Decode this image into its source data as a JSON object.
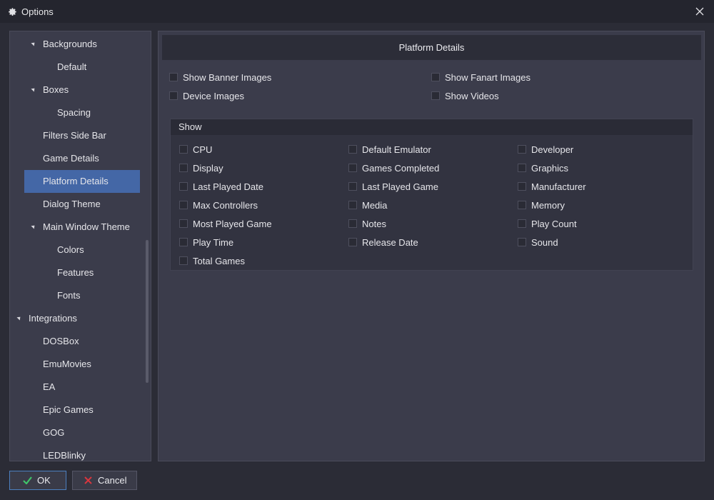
{
  "window": {
    "title": "Options"
  },
  "sidebar": {
    "items": [
      {
        "label": "Backgrounds",
        "level": 1,
        "expanded": true
      },
      {
        "label": "Default",
        "level": 2
      },
      {
        "label": "Boxes",
        "level": 1,
        "expanded": true
      },
      {
        "label": "Spacing",
        "level": 2
      },
      {
        "label": "Filters Side Bar",
        "level": 1
      },
      {
        "label": "Game Details",
        "level": 1
      },
      {
        "label": "Platform Details",
        "level": 1,
        "selected": true
      },
      {
        "label": "Dialog Theme",
        "level": 1
      },
      {
        "label": "Main Window Theme",
        "level": 1,
        "expanded": true
      },
      {
        "label": "Colors",
        "level": 2
      },
      {
        "label": "Features",
        "level": 2
      },
      {
        "label": "Fonts",
        "level": 2
      },
      {
        "label": "Integrations",
        "level": 0,
        "expanded": true
      },
      {
        "label": "DOSBox",
        "level": 1
      },
      {
        "label": "EmuMovies",
        "level": 1
      },
      {
        "label": "EA",
        "level": 1
      },
      {
        "label": "Epic Games",
        "level": 1
      },
      {
        "label": "GOG",
        "level": 1
      },
      {
        "label": "LEDBlinky",
        "level": 1
      }
    ]
  },
  "main": {
    "header": "Platform Details",
    "top_options": [
      {
        "label": "Show Banner Images",
        "checked": false
      },
      {
        "label": "Show Fanart Images",
        "checked": false
      },
      {
        "label": "Device Images",
        "checked": false
      },
      {
        "label": "Show Videos",
        "checked": false
      }
    ],
    "show_group": {
      "title": "Show",
      "options": [
        {
          "label": "CPU",
          "checked": false
        },
        {
          "label": "Default Emulator",
          "checked": false
        },
        {
          "label": "Developer",
          "checked": false
        },
        {
          "label": "Display",
          "checked": false
        },
        {
          "label": "Games Completed",
          "checked": false
        },
        {
          "label": "Graphics",
          "checked": false
        },
        {
          "label": "Last Played Date",
          "checked": false
        },
        {
          "label": "Last Played Game",
          "checked": false
        },
        {
          "label": "Manufacturer",
          "checked": false
        },
        {
          "label": "Max Controllers",
          "checked": false
        },
        {
          "label": "Media",
          "checked": false
        },
        {
          "label": "Memory",
          "checked": false
        },
        {
          "label": "Most Played Game",
          "checked": false
        },
        {
          "label": "Notes",
          "checked": false
        },
        {
          "label": "Play Count",
          "checked": false
        },
        {
          "label": "Play Time",
          "checked": false
        },
        {
          "label": "Release Date",
          "checked": false
        },
        {
          "label": "Sound",
          "checked": false
        },
        {
          "label": "Total Games",
          "checked": false
        }
      ]
    }
  },
  "footer": {
    "ok_label": "OK",
    "cancel_label": "Cancel"
  },
  "colors": {
    "selection": "#4467a6",
    "ok_check": "#3fc46a",
    "cancel_x": "#d9363e"
  }
}
